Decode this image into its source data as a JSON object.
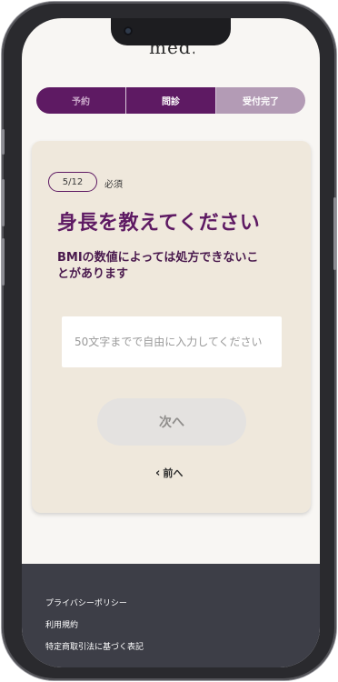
{
  "header": {
    "logo_text": "med."
  },
  "steps": [
    {
      "label": "予約"
    },
    {
      "label": "問診"
    },
    {
      "label": "受付完了"
    }
  ],
  "question": {
    "progress": "5/12",
    "required_label": "必須",
    "title": "身長を教えてください",
    "note": "BMIの数値によっては処方できないことがあります",
    "input_value": "",
    "input_placeholder": "50文字までで自由に入力してください",
    "next_label": "次へ",
    "prev_label": "前へ"
  },
  "footer": {
    "links": [
      {
        "label": "プライバシーポリシー"
      },
      {
        "label": "利用規約"
      },
      {
        "label": "特定商取引法に基づく表記"
      }
    ]
  },
  "colors": {
    "brand_purple": "#5e1a63",
    "step_inactive": "#b39bb5",
    "card_bg": "#efe8dc",
    "footer_bg": "#3d3e47"
  },
  "icons": {
    "prev": "chevron-left-icon",
    "camera": "front-camera-icon"
  }
}
